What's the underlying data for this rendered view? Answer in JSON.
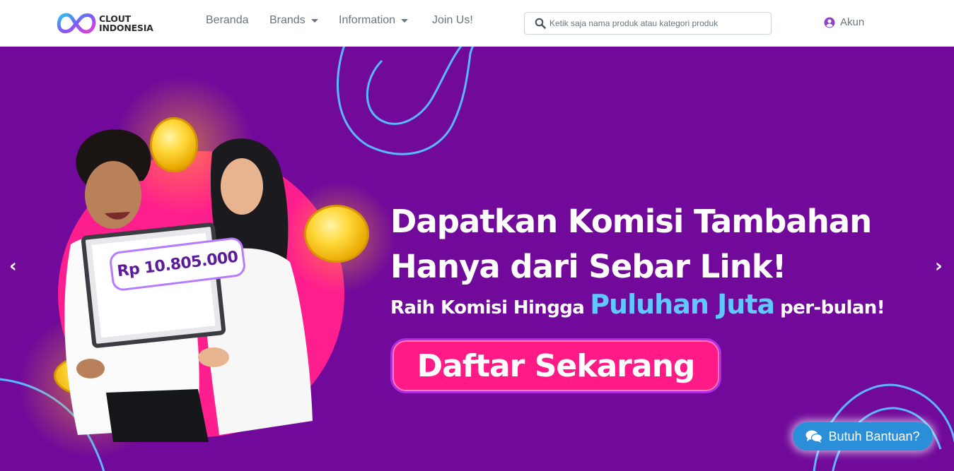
{
  "brand": {
    "line1": "CLOUT",
    "line2": "INDONESIA"
  },
  "nav": {
    "home": "Beranda",
    "brands": "Brands",
    "information": "Information",
    "join": "Join Us!"
  },
  "search": {
    "placeholder": "Ketik saja nama produk atau kategori produk"
  },
  "account": {
    "label": "Akun"
  },
  "hero": {
    "headline_line1": "Dapatkan Komisi Tambahan",
    "headline_line2": "Hanya dari Sebar Link!",
    "sub_prefix": "Raih Komisi Hingga",
    "sub_highlight": "Puluhan Juta",
    "sub_suffix": "per-bulan!",
    "cta": "Daftar Sekarang",
    "price_tag": "Rp 10.805.000",
    "prev": "‹",
    "next": "›"
  },
  "help": {
    "label": "Butuh Bantuan?"
  },
  "colors": {
    "hero_bg": "#71099a",
    "accent_pink": "#ff1a85",
    "accent_blue": "#5ec8ff",
    "help_button": "#2a8fd8"
  }
}
